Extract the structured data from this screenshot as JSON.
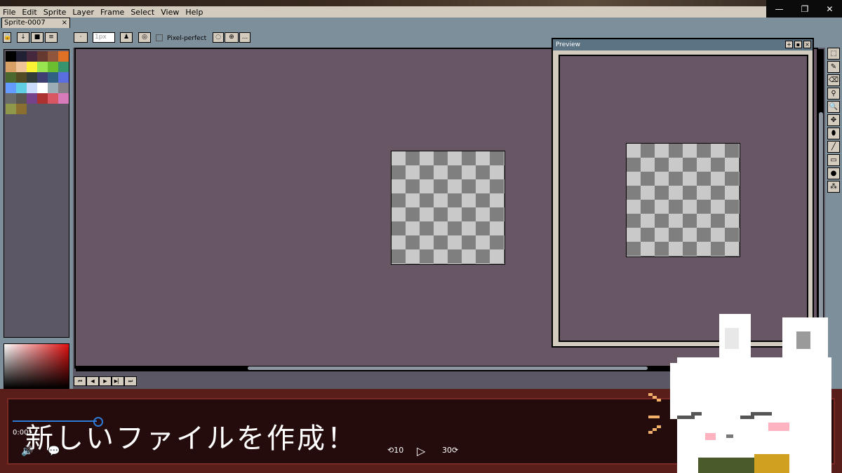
{
  "menu": {
    "items": [
      "File",
      "Edit",
      "Sprite",
      "Layer",
      "Frame",
      "Select",
      "View",
      "Help"
    ]
  },
  "window_controls": [
    "—",
    "❐",
    "✕"
  ],
  "tabs": [
    {
      "label": "Sprite-0007",
      "close": "×"
    }
  ],
  "toolbar": {
    "brush_size": "1px",
    "pixel_perfect_label": "Pixel-perfect",
    "more_label": "..."
  },
  "preview": {
    "title": "Preview"
  },
  "palette": {
    "colors": [
      "#000000",
      "#222034",
      "#45283c",
      "#663931",
      "#8f563b",
      "#df7126",
      "#d9a066",
      "#eec39a",
      "#fbf236",
      "#99e550",
      "#6abe30",
      "#37946e",
      "#4b692f",
      "#524b24",
      "#323c39",
      "#3f3f74",
      "#306082",
      "#5b6ee1",
      "#639bff",
      "#5fcde4",
      "#cbdbfc",
      "#ffffff",
      "#9badb7",
      "#847e87",
      "#696a6a",
      "#595652",
      "#76428a",
      "#ac3232",
      "#d95763",
      "#d77bba",
      "#8f974a",
      "#8a6f30"
    ]
  },
  "player": {
    "time": "0:00:",
    "subtitle": "新しいファイルを作成！",
    "volume_icon": "🔊",
    "cc_icon": "💬",
    "rewind_label": "10",
    "forward_label": "30",
    "play_icon": "▷"
  }
}
